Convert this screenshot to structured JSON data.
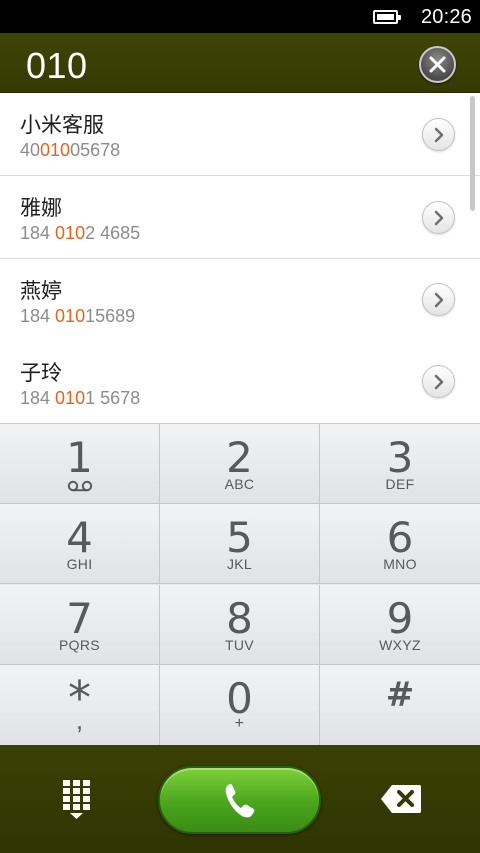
{
  "status": {
    "time": "20:26",
    "battery_level": 1.0
  },
  "dialer": {
    "dialed_number": "010"
  },
  "results": [
    {
      "name": "小米客服",
      "num_pre": "40",
      "num_match": "010",
      "num_post": "05678"
    },
    {
      "name": "雅娜",
      "num_pre": "184 ",
      "num_match": "010",
      "num_post": "2 4685"
    },
    {
      "name": "燕婷",
      "num_pre": "184 ",
      "num_match": "010",
      "num_post": "15689"
    },
    {
      "name": "子玲",
      "num_pre": "184 ",
      "num_match": "010",
      "num_post": "1 5678"
    }
  ],
  "keypad": {
    "keys": [
      {
        "digit": "1",
        "letters": ""
      },
      {
        "digit": "2",
        "letters": "ABC"
      },
      {
        "digit": "3",
        "letters": "DEF"
      },
      {
        "digit": "4",
        "letters": "GHI"
      },
      {
        "digit": "5",
        "letters": "JKL"
      },
      {
        "digit": "6",
        "letters": "MNO"
      },
      {
        "digit": "7",
        "letters": "PQRS"
      },
      {
        "digit": "8",
        "letters": "TUV"
      },
      {
        "digit": "9",
        "letters": "WXYZ"
      },
      {
        "digit": "*",
        "letters": ","
      },
      {
        "digit": "0",
        "letters": "+"
      },
      {
        "digit": "#",
        "letters": ""
      }
    ]
  },
  "colors": {
    "accent_bar": "#3a4004",
    "match_highlight": "#e8631a",
    "call_green": "#4aa51d"
  },
  "icons": {
    "voicemail": "voicemail-icon",
    "clear": "close-icon",
    "detail": "chevron-right-icon",
    "keypad_toggle": "keypad-grid-icon",
    "call": "phone-handset-icon",
    "backspace": "backspace-icon"
  }
}
